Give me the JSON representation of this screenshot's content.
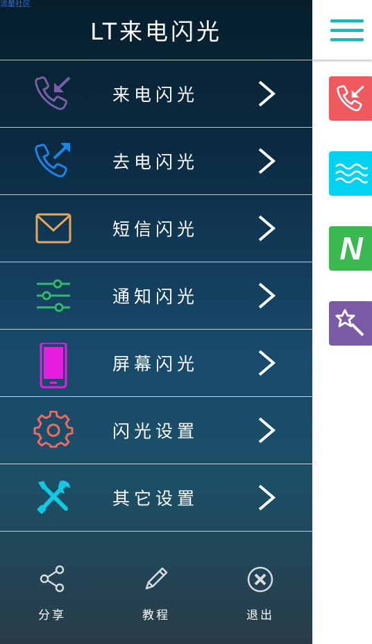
{
  "top_overlay_text": "流量社区",
  "drawer": {
    "title": "LT来电闪光",
    "menu": [
      {
        "label": "来电闪光",
        "icon": "incoming-call-icon",
        "color": "#7b5ea8"
      },
      {
        "label": "去电闪光",
        "icon": "outgoing-call-icon",
        "color": "#1b86e6"
      },
      {
        "label": "短信闪光",
        "icon": "envelope-icon",
        "color": "#e8a85a"
      },
      {
        "label": "通知闪光",
        "icon": "sliders-icon",
        "color": "#35b96a"
      },
      {
        "label": "屏幕闪光",
        "icon": "phone-screen-icon",
        "color": "#e51ee0"
      },
      {
        "label": "闪光设置",
        "icon": "gear-icon",
        "color": "#f06a60"
      },
      {
        "label": "其它设置",
        "icon": "tools-icon",
        "color": "#12c9e4"
      }
    ],
    "bottom": [
      {
        "label": "分享",
        "icon": "share-icon"
      },
      {
        "label": "教程",
        "icon": "pencil-icon"
      },
      {
        "label": "退出",
        "icon": "close-circle-icon"
      }
    ]
  },
  "right_panel": {
    "menu_icon": "hamburger-icon",
    "tiles": [
      {
        "icon": "incoming-call-icon",
        "color": "#ef5a5f"
      },
      {
        "icon": "waves-icon",
        "color": "#00d2f0"
      },
      {
        "icon": "n-letter-icon",
        "text": "N",
        "color": "#3cb850"
      },
      {
        "icon": "magic-wand-icon",
        "color": "#7b5aa6"
      }
    ]
  }
}
